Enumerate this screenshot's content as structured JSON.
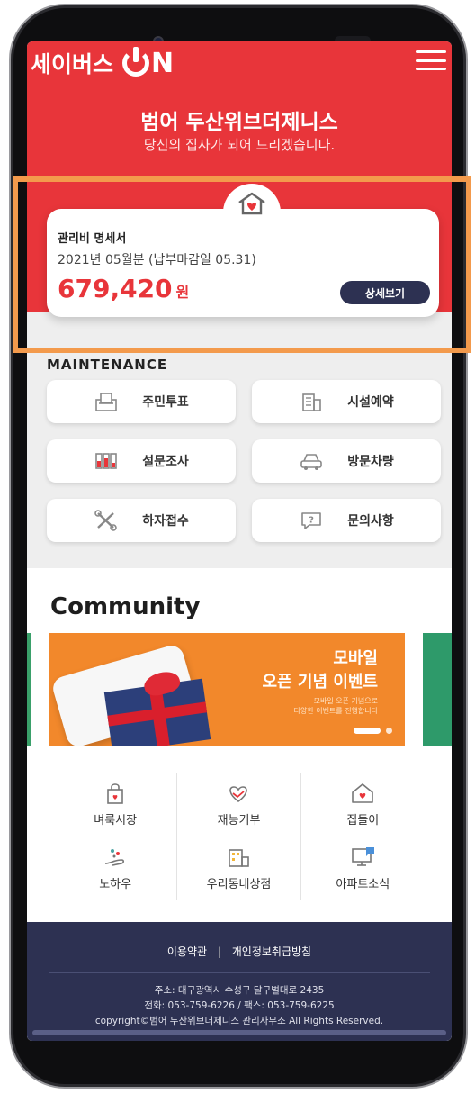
{
  "app": {
    "logo_text": "세이버스",
    "logo_suffix": "N"
  },
  "hero": {
    "title": "범어 두산위브더제니스",
    "subtitle": "당신의 집사가 되어 드리겠습니다."
  },
  "bill": {
    "label": "관리비 명세서",
    "period": "2021년 05월분 (납부마감일 05.31)",
    "amount": "679,420",
    "unit": "원",
    "detail_button": "상세보기",
    "icon": "house-heart-icon"
  },
  "maintenance": {
    "title": "MAINTENANCE",
    "items": [
      {
        "label": "주민투표",
        "icon": "ballot-box-icon"
      },
      {
        "label": "시설예약",
        "icon": "building-icon"
      },
      {
        "label": "설문조사",
        "icon": "survey-icon"
      },
      {
        "label": "방문차량",
        "icon": "car-icon"
      },
      {
        "label": "하자접수",
        "icon": "tools-icon"
      },
      {
        "label": "문의사항",
        "icon": "question-chat-icon"
      }
    ]
  },
  "community": {
    "title": "Community",
    "banner": {
      "title_line1": "모바일",
      "title_line2": "오픈 기념 이벤트",
      "small_line1": "모바일 오픈 기념으로",
      "small_line2": "다양한 이벤트를 진행합니다"
    },
    "items": [
      {
        "label": "벼룩시장",
        "icon": "shopping-bag-icon"
      },
      {
        "label": "재능기부",
        "icon": "handshake-heart-icon"
      },
      {
        "label": "집들이",
        "icon": "home-heart-icon"
      },
      {
        "label": "노하우",
        "icon": "hand-sparkle-icon"
      },
      {
        "label": "우리동네상점",
        "icon": "store-icon"
      },
      {
        "label": "아파트소식",
        "icon": "monitor-news-icon"
      }
    ]
  },
  "footer": {
    "terms": "이용약관",
    "separator": "|",
    "privacy": "개인정보취급방침",
    "address": "주소: 대구광역시 수성구 달구벌대로 2435",
    "contact": "전화: 053-759-6226 / 팩스: 053-759-6225",
    "copyright": "copyright©범어 두산위브더제니스 관리사무소 All Rights Reserved."
  },
  "colors": {
    "brand_red": "#e8353a",
    "navy": "#2d3152",
    "highlight": "#f39a4c",
    "banner_orange": "#f2882b"
  }
}
